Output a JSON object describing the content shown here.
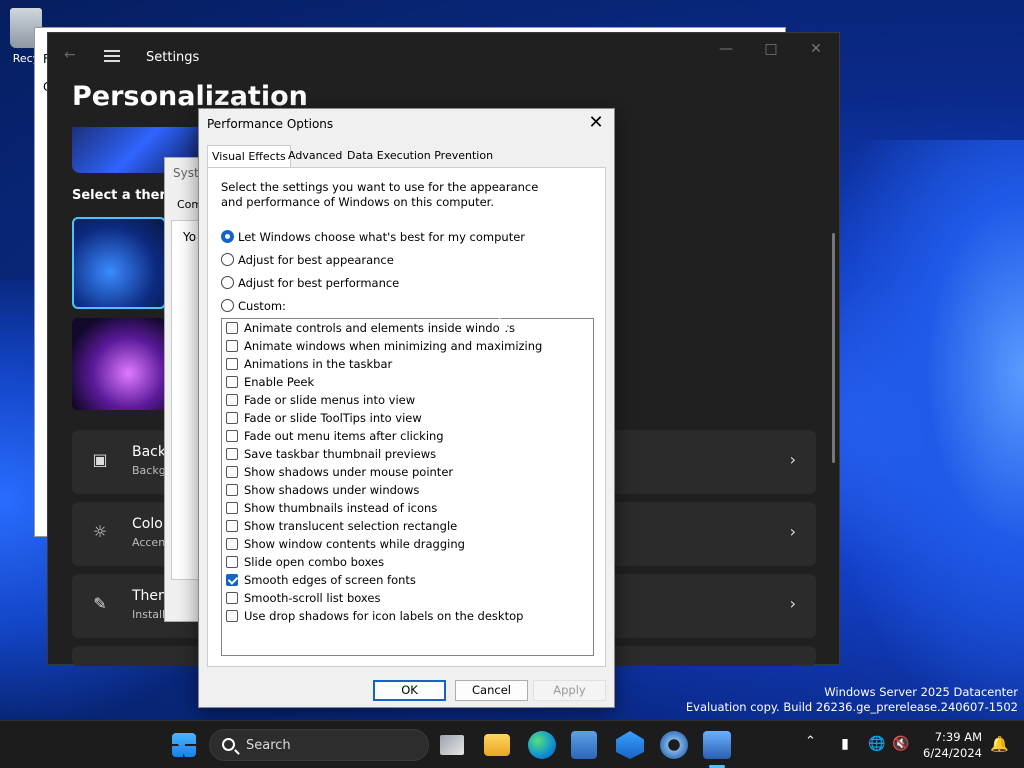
{
  "desktop": {
    "recycle_label": "Recy"
  },
  "explorer": {
    "frag1": "F",
    "frag2": "C"
  },
  "settings": {
    "title": "Settings",
    "page_title": "Personalization",
    "select_theme": "Select a theme",
    "rows": [
      {
        "title": "Backg",
        "subtitle": "Backg"
      },
      {
        "title": "Color",
        "subtitle": "Accen"
      },
      {
        "title": "Them",
        "subtitle": "Install"
      }
    ]
  },
  "sysprops": {
    "title": "Syste",
    "tab": "Com",
    "frag": "Yo"
  },
  "perf": {
    "title": "Performance Options",
    "tabs": [
      "Visual Effects",
      "Advanced",
      "Data Execution Prevention"
    ],
    "description": "Select the settings you want to use for the appearance and performance of Windows on this computer.",
    "radios": [
      {
        "label": "Let Windows choose what's best for my computer",
        "selected": true
      },
      {
        "label": "Adjust for best appearance",
        "selected": false
      },
      {
        "label": "Adjust for best performance",
        "selected": false
      },
      {
        "label": "Custom:",
        "selected": false
      }
    ],
    "checkboxes": [
      {
        "label": "Animate controls and elements inside windows",
        "checked": false
      },
      {
        "label": "Animate windows when minimizing and maximizing",
        "checked": false
      },
      {
        "label": "Animations in the taskbar",
        "checked": false
      },
      {
        "label": "Enable Peek",
        "checked": false
      },
      {
        "label": "Fade or slide menus into view",
        "checked": false
      },
      {
        "label": "Fade or slide ToolTips into view",
        "checked": false
      },
      {
        "label": "Fade out menu items after clicking",
        "checked": false
      },
      {
        "label": "Save taskbar thumbnail previews",
        "checked": false
      },
      {
        "label": "Show shadows under mouse pointer",
        "checked": false
      },
      {
        "label": "Show shadows under windows",
        "checked": false
      },
      {
        "label": "Show thumbnails instead of icons",
        "checked": false
      },
      {
        "label": "Show translucent selection rectangle",
        "checked": false
      },
      {
        "label": "Show window contents while dragging",
        "checked": false
      },
      {
        "label": "Slide open combo boxes",
        "checked": false
      },
      {
        "label": "Smooth edges of screen fonts",
        "checked": true
      },
      {
        "label": "Smooth-scroll list boxes",
        "checked": false
      },
      {
        "label": "Use drop shadows for icon labels on the desktop",
        "checked": false
      }
    ],
    "buttons": {
      "ok": "OK",
      "cancel": "Cancel",
      "apply": "Apply"
    }
  },
  "watermark": {
    "line1": "Windows Server 2025 Datacenter",
    "line2": "Evaluation copy. Build 26236.ge_prerelease.240607-1502"
  },
  "taskbar": {
    "search_placeholder": "Search",
    "time": "7:39 AM",
    "date": "6/24/2024"
  }
}
